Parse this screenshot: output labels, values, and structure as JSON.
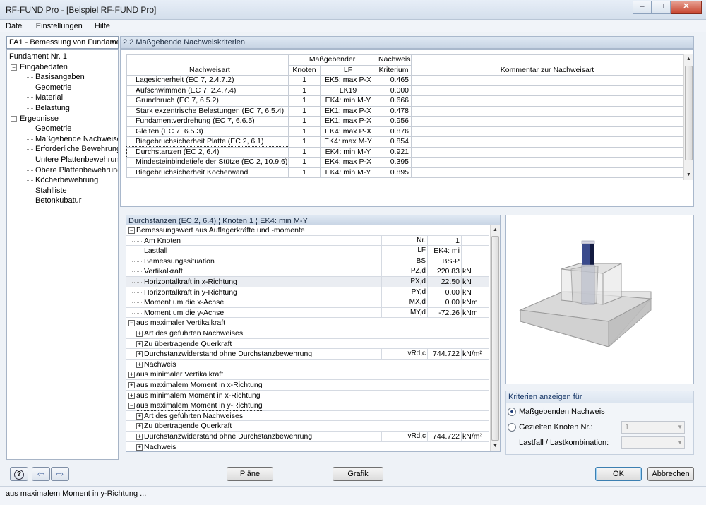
{
  "window": {
    "title": "RF-FUND Pro - [Beispiel RF-FUND Pro]",
    "close_glyph": "✕",
    "max_glyph": "□",
    "min_glyph": "–"
  },
  "menu": {
    "items": [
      "Datei",
      "Einstellungen",
      "Hilfe"
    ]
  },
  "nav": {
    "selector": "FA1 - Bemessung von Fundame",
    "tree": [
      {
        "label": "Fundament Nr. 1",
        "level": 0
      },
      {
        "label": "Eingabedaten",
        "level": 1,
        "expander": "−"
      },
      {
        "label": "Basisangaben",
        "level": 2
      },
      {
        "label": "Geometrie",
        "level": 2
      },
      {
        "label": "Material",
        "level": 2
      },
      {
        "label": "Belastung",
        "level": 2
      },
      {
        "label": "Ergebnisse",
        "level": 1,
        "expander": "−"
      },
      {
        "label": "Geometrie",
        "level": 2
      },
      {
        "label": "Maßgebende Nachweise",
        "level": 2
      },
      {
        "label": "Erforderliche Bewehrung",
        "level": 2
      },
      {
        "label": "Untere Plattenbewehrung",
        "level": 2
      },
      {
        "label": "Obere Plattenbewehrung",
        "level": 2
      },
      {
        "label": "Köcherbewehrung",
        "level": 2
      },
      {
        "label": "Stahlliste",
        "level": 2
      },
      {
        "label": "Betonkubatur",
        "level": 2
      }
    ]
  },
  "main": {
    "title": "2.2 Maßgebende Nachweiskriterien",
    "columns": {
      "nachweisart": "Nachweisart",
      "massgebender": "Maßgebender",
      "knoten": "Knoten",
      "lf": "LF",
      "kriterium_1": "Nachweis-",
      "kriterium_2": "Kriterium",
      "kommentar": "Kommentar zur Nachweisart"
    },
    "rows": [
      {
        "art": "Lagesicherheit (EC 7, 2.4.7.2)",
        "knoten": "1",
        "lf": "EK5: max P-X",
        "krit": "0.465"
      },
      {
        "art": "Aufschwimmen (EC 7, 2.4.7.4)",
        "knoten": "1",
        "lf": "LK19",
        "krit": "0.000"
      },
      {
        "art": "Grundbruch (EC 7, 6.5.2)",
        "knoten": "1",
        "lf": "EK4: min M-Y",
        "krit": "0.666"
      },
      {
        "art": "Stark exzentrische Belastungen (EC 7, 6.5.4)",
        "knoten": "1",
        "lf": "EK1: max P-X",
        "krit": "0.478"
      },
      {
        "art": "Fundamentverdrehung (EC 7, 6.6.5)",
        "knoten": "1",
        "lf": "EK1: max P-X",
        "krit": "0.956"
      },
      {
        "art": "Gleiten (EC 7, 6.5.3)",
        "knoten": "1",
        "lf": "EK4: max P-X",
        "krit": "0.876"
      },
      {
        "art": "Biegebruchsicherheit Platte (EC 2, 6.1)",
        "knoten": "1",
        "lf": "EK4: max M-Y",
        "krit": "0.854"
      },
      {
        "art": "Durchstanzen (EC 2, 6.4)",
        "knoten": "1",
        "lf": "EK4: min M-Y",
        "krit": "0.921"
      },
      {
        "art": "Mindesteinbindetiefe der Stütze (EC 2, 10.9.6)",
        "knoten": "1",
        "lf": "EK4: max P-X",
        "krit": "0.395"
      },
      {
        "art": "Biegebruchsicherheit Köcherwand",
        "knoten": "1",
        "lf": "EK4: min M-Y",
        "krit": "0.895"
      }
    ]
  },
  "detail": {
    "title": "Durchstanzen (EC 2, 6.4) ¦ Knoten 1 ¦ EK4: min M-Y",
    "rows": [
      {
        "label": "Bemessungswert aus Auflagerkräfte und -momente",
        "box": "−",
        "level": 0
      },
      {
        "label": "Am Knoten",
        "level": 2,
        "sym": "Nr.",
        "val": "1"
      },
      {
        "label": "Lastfall",
        "level": 2,
        "sym": "LF",
        "val": "EK4: mi"
      },
      {
        "label": "Bemessungssituation",
        "level": 2,
        "sym": "BS",
        "val": "BS-P"
      },
      {
        "label": "Vertikalkraft",
        "level": 2,
        "sym": "PZ,d",
        "val": "220.83",
        "unit": "kN"
      },
      {
        "label": "Horizontalkraft in x-Richtung",
        "level": 2,
        "sym": "PX,d",
        "val": "22.50",
        "unit": "kN",
        "hl": true
      },
      {
        "label": "Horizontalkraft in y-Richtung",
        "level": 2,
        "sym": "PY,d",
        "val": "0.00",
        "unit": "kN"
      },
      {
        "label": "Moment um die x-Achse",
        "level": 2,
        "sym": "MX,d",
        "val": "0.00",
        "unit": "kNm"
      },
      {
        "label": "Moment um die y-Achse",
        "level": 2,
        "sym": "MY,d",
        "val": "-72.26",
        "unit": "kNm"
      },
      {
        "label": "aus maximaler Vertikalkraft",
        "box": "−",
        "level": 0
      },
      {
        "label": "Art des geführten Nachweises",
        "box": "+",
        "level": 1
      },
      {
        "label": "Zu übertragende Querkraft",
        "box": "+",
        "level": 1
      },
      {
        "label": "Durchstanzwiderstand ohne Durchstanzbewehrung",
        "box": "+",
        "level": 1,
        "sym": "vRd,c",
        "val": "744.722",
        "unit": "kN/m²"
      },
      {
        "label": "Nachweis",
        "box": "+",
        "level": 1
      },
      {
        "label": "aus minimaler Vertikalkraft",
        "box": "+",
        "level": 0
      },
      {
        "label": "aus maximalem Moment in x-Richtung",
        "box": "+",
        "level": 0
      },
      {
        "label": "aus minimalem Moment in x-Richtung",
        "box": "+",
        "level": 0
      },
      {
        "label": "aus maximalem Moment in y-Richtung",
        "box": "−",
        "level": 0,
        "focus": true
      },
      {
        "label": "Art des geführten Nachweises",
        "box": "+",
        "level": 1
      },
      {
        "label": "Zu übertragende Querkraft",
        "box": "+",
        "level": 1
      },
      {
        "label": "Durchstanzwiderstand ohne Durchstanzbewehrung",
        "box": "+",
        "level": 1,
        "sym": "vRd,c",
        "val": "744.722",
        "unit": "kN/m²"
      },
      {
        "label": "Nachweis",
        "box": "+",
        "level": 1
      }
    ]
  },
  "criteria": {
    "header": "Kriterien anzeigen für",
    "option1": "Maßgebenden Nachweis",
    "option2": "Gezielten Knoten Nr.:",
    "knoten_value": "1",
    "lastfall_label": "Lastfall / Lastkombination:"
  },
  "buttons": {
    "plaene": "Pläne",
    "grafik": "Grafik",
    "ok": "OK",
    "abbrechen": "Abbrechen"
  },
  "status": "aus maximalem Moment in y-Richtung ..."
}
